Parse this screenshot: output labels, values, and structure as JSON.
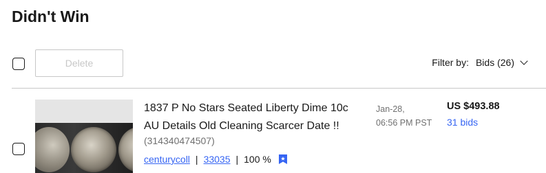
{
  "page": {
    "title": "Didn't Win"
  },
  "toolbar": {
    "delete_label": "Delete",
    "filter_label": "Filter by:",
    "filter_value": "Bids (26)"
  },
  "items": [
    {
      "title_line1": "1837 P No Stars Seated Liberty Dime 10c",
      "title_line2": "AU Details Old Cleaning Scarcer Date !!",
      "item_number": "(314340474507)",
      "seller": "centurycoll",
      "feedback_score": "33035",
      "feedback_percent": "100 %",
      "date_line1": "Jan-28,",
      "date_line2": "06:56 PM PST",
      "price": "US $493.88",
      "bids": "31 bids"
    }
  ],
  "colors": {
    "link": "#3665f3",
    "text": "#191919",
    "muted": "#707070",
    "border": "#c7c7c7"
  },
  "icons": {
    "filter": "chevron-down-icon",
    "seller_badge": "top-rated-seller-icon"
  }
}
